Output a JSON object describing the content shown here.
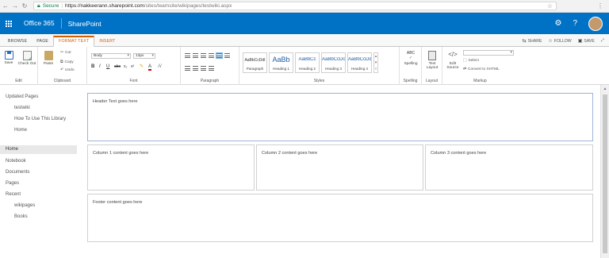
{
  "browser": {
    "security_label": "Secure",
    "url_host": "https://nakkeerann.sharepoint.com",
    "url_path": "/sites/teamsite/wikipages/testwiki.aspx"
  },
  "suite": {
    "brand": "Office 365",
    "app": "SharePoint"
  },
  "ribbon_tabs": [
    "BROWSE",
    "PAGE",
    "FORMAT TEXT",
    "INSERT"
  ],
  "ribbon_actions": {
    "share": "SHARE",
    "follow": "FOLLOW",
    "save": "SAVE"
  },
  "ribbon": {
    "edit": {
      "save": "Save",
      "checkout": "Check Out",
      "label": "Edit"
    },
    "clipboard": {
      "paste": "Paste",
      "cut": "Cut",
      "copy": "Copy",
      "undo": "Undo",
      "label": "Clipboard"
    },
    "font": {
      "family": "Body",
      "size": "13px",
      "label": "Font"
    },
    "paragraph": {
      "label": "Paragraph"
    },
    "styles": {
      "items": [
        {
          "sample": "AaBbCcDdI",
          "name": "Paragraph"
        },
        {
          "sample": "AaBb",
          "name": "Heading 1"
        },
        {
          "sample": "AaBbCc",
          "name": "Heading 2"
        },
        {
          "sample": "AaBbCcDc",
          "name": "Heading 3"
        },
        {
          "sample": "AaBbCcDd",
          "name": "Heading 4"
        }
      ],
      "label": "Styles"
    },
    "spelling": {
      "button": "Spelling",
      "label": "Spelling"
    },
    "layout": {
      "button": "Text Layout",
      "label": "Layout"
    },
    "markup": {
      "edit_source": "Edit Source",
      "select": "Select",
      "convert": "Convert to XHTML",
      "label": "Markup"
    }
  },
  "leftnav": {
    "recent_heading": "Updated Pages",
    "recent": [
      "testwiki",
      "How To Use This Library",
      "Home"
    ],
    "main": [
      "Home",
      "Notebook",
      "Documents",
      "Pages",
      "Recent"
    ],
    "recent_sub": [
      "wikipages",
      "Books"
    ]
  },
  "zones": {
    "header": "Header Text goes here",
    "col1": "Column 1 content goes here",
    "col2": "Column 2 content goes here",
    "col3": "Column 3 content goes here",
    "footer": "Footer content goes here"
  }
}
